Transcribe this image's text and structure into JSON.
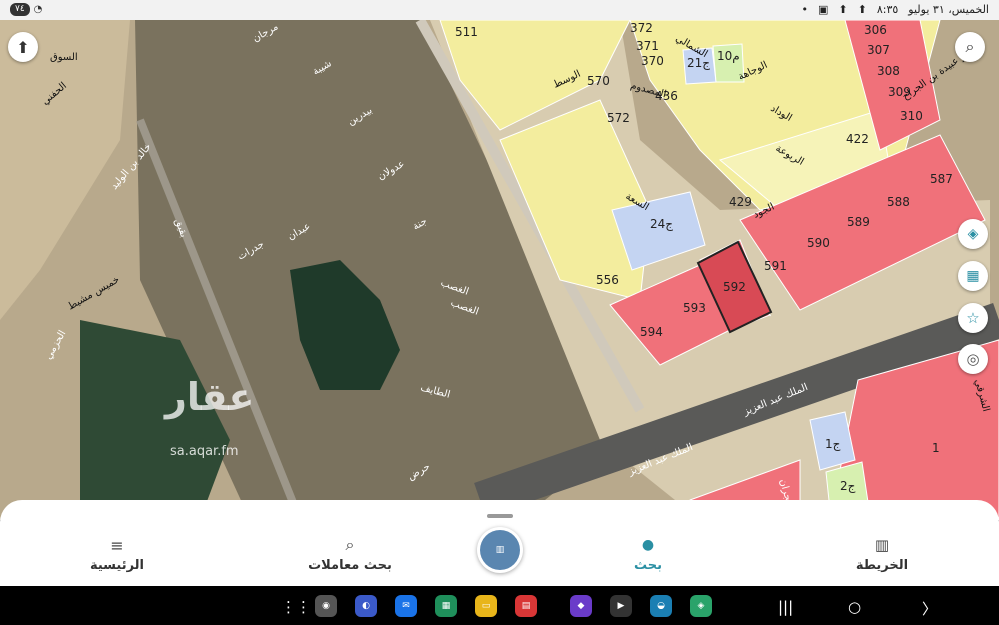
{
  "statusbar": {
    "datetime": "الخميس، ٣١ يوليو",
    "time": "٨:٣٥",
    "battery": "٧٤"
  },
  "map": {
    "plots_red": [
      "306",
      "307",
      "308",
      "309",
      "310",
      "587",
      "588",
      "589",
      "590",
      "591",
      "592",
      "593",
      "594",
      "1"
    ],
    "plots_yellow": [
      "511",
      "570",
      "572",
      "422",
      "429",
      "436",
      "372",
      "371",
      "370",
      "556"
    ],
    "plots_blue": [
      "ج21",
      "ج24",
      "ج1"
    ],
    "plots_green": [
      "10م",
      "2ج"
    ],
    "streets": [
      "الوسط",
      "الوجاهة",
      "الوداد",
      "الربوعة",
      "الجود",
      "السعة",
      "المصدوم",
      "الشمالي",
      "أبو عبيدة بن الجراح",
      "الملك عبد العزيز",
      "الملك عبد العزيز",
      "حرض",
      "الطايف",
      "الغصب",
      "الغصب",
      "جنة",
      "عبدان",
      "عدولان",
      "بيدرين",
      "شيبة",
      "مرجان",
      "الحفني",
      "خالد بن الوليد",
      "الحزمي",
      "خميس مشيط",
      "بقيق",
      "نجران",
      "جدرات",
      "السوق",
      "الشرقي"
    ],
    "selected_plot": "592",
    "watermark": "عقار",
    "watermark_url": "sa.aqar.fm"
  },
  "bottom_nav": {
    "home": "الرئيسية",
    "transactions": "بحث معاملات",
    "search": "بحث",
    "map": "الخريطة"
  },
  "colors": {
    "accent": "#2a8fa3",
    "plot_red": "#f0717a",
    "plot_yellow": "#f5f0a6",
    "plot_blue": "#c4d4f2",
    "selected": "#d84a55"
  }
}
